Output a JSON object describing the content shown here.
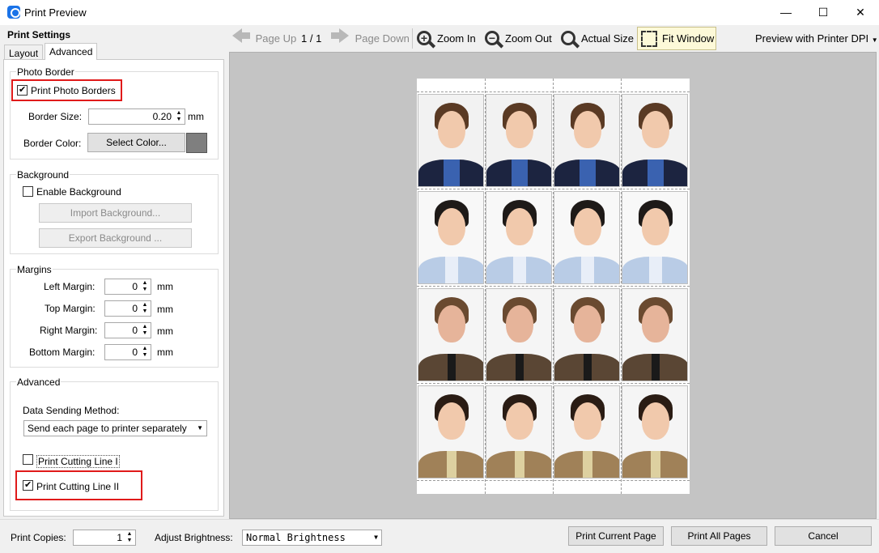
{
  "window": {
    "title": "Print Preview",
    "minimize_glyph": "—",
    "maximize_glyph": "☐",
    "close_glyph": "✕"
  },
  "left_panel": {
    "title": "Print Settings",
    "tabs": [
      {
        "label": "Layout",
        "active": false
      },
      {
        "label": "Advanced",
        "active": true
      }
    ],
    "photo_border": {
      "group_label": "Photo Border",
      "print_borders_label": "Print Photo Borders",
      "print_borders_checked": true,
      "border_size_label": "Border Size:",
      "border_size_value": "0.20",
      "border_size_unit": "mm",
      "border_color_label": "Border Color:",
      "select_color_label": "Select Color...",
      "border_color": "#7f7f7f"
    },
    "background": {
      "group_label": "Background",
      "enable_label": "Enable Background",
      "enable_checked": false,
      "import_label": "Import Background...",
      "export_label": "Export Background ..."
    },
    "margins": {
      "group_label": "Margins",
      "items": [
        {
          "label": "Left Margin:",
          "value": "0",
          "unit": "mm"
        },
        {
          "label": "Top Margin:",
          "value": "0",
          "unit": "mm"
        },
        {
          "label": "Right Margin:",
          "value": "0",
          "unit": "mm"
        },
        {
          "label": "Bottom Margin:",
          "value": "0",
          "unit": "mm"
        }
      ]
    },
    "advanced": {
      "group_label": "Advanced",
      "data_sending_label": "Data Sending Method:",
      "data_sending_value": "Send each page to printer separately",
      "cutting_line_1_label": "Print Cutting Line I",
      "cutting_line_1_checked": false,
      "cutting_line_2_label": "Print Cutting Line II",
      "cutting_line_2_checked": true
    }
  },
  "toolbar": {
    "page_up_label": "Page Up",
    "page_indicator": "1 / 1",
    "page_down_label": "Page Down",
    "zoom_in_label": "Zoom In",
    "zoom_out_label": "Zoom Out",
    "actual_size_label": "Actual Size",
    "fit_window_label": "Fit Window",
    "dpi_label": "Preview with Printer DPI"
  },
  "bottom": {
    "copies_label": "Print Copies:",
    "copies_value": "1",
    "brightness_label": "Adjust Brightness:",
    "brightness_value": "Normal Brightness",
    "print_current_label": "Print Current Page",
    "print_all_label": "Print All Pages",
    "cancel_label": "Cancel"
  },
  "preview": {
    "rows": [
      {
        "subject": "woman-bowtie"
      },
      {
        "subject": "woman-light-blue-shirt"
      },
      {
        "subject": "bearded-man-brown-suit"
      },
      {
        "subject": "young-man-tan-suit"
      }
    ],
    "columns": 4
  },
  "colors": {
    "highlight_red": "#e01a1a",
    "fit_window_bg": "#fdf9d8",
    "preview_bg": "#c4c4c4"
  }
}
